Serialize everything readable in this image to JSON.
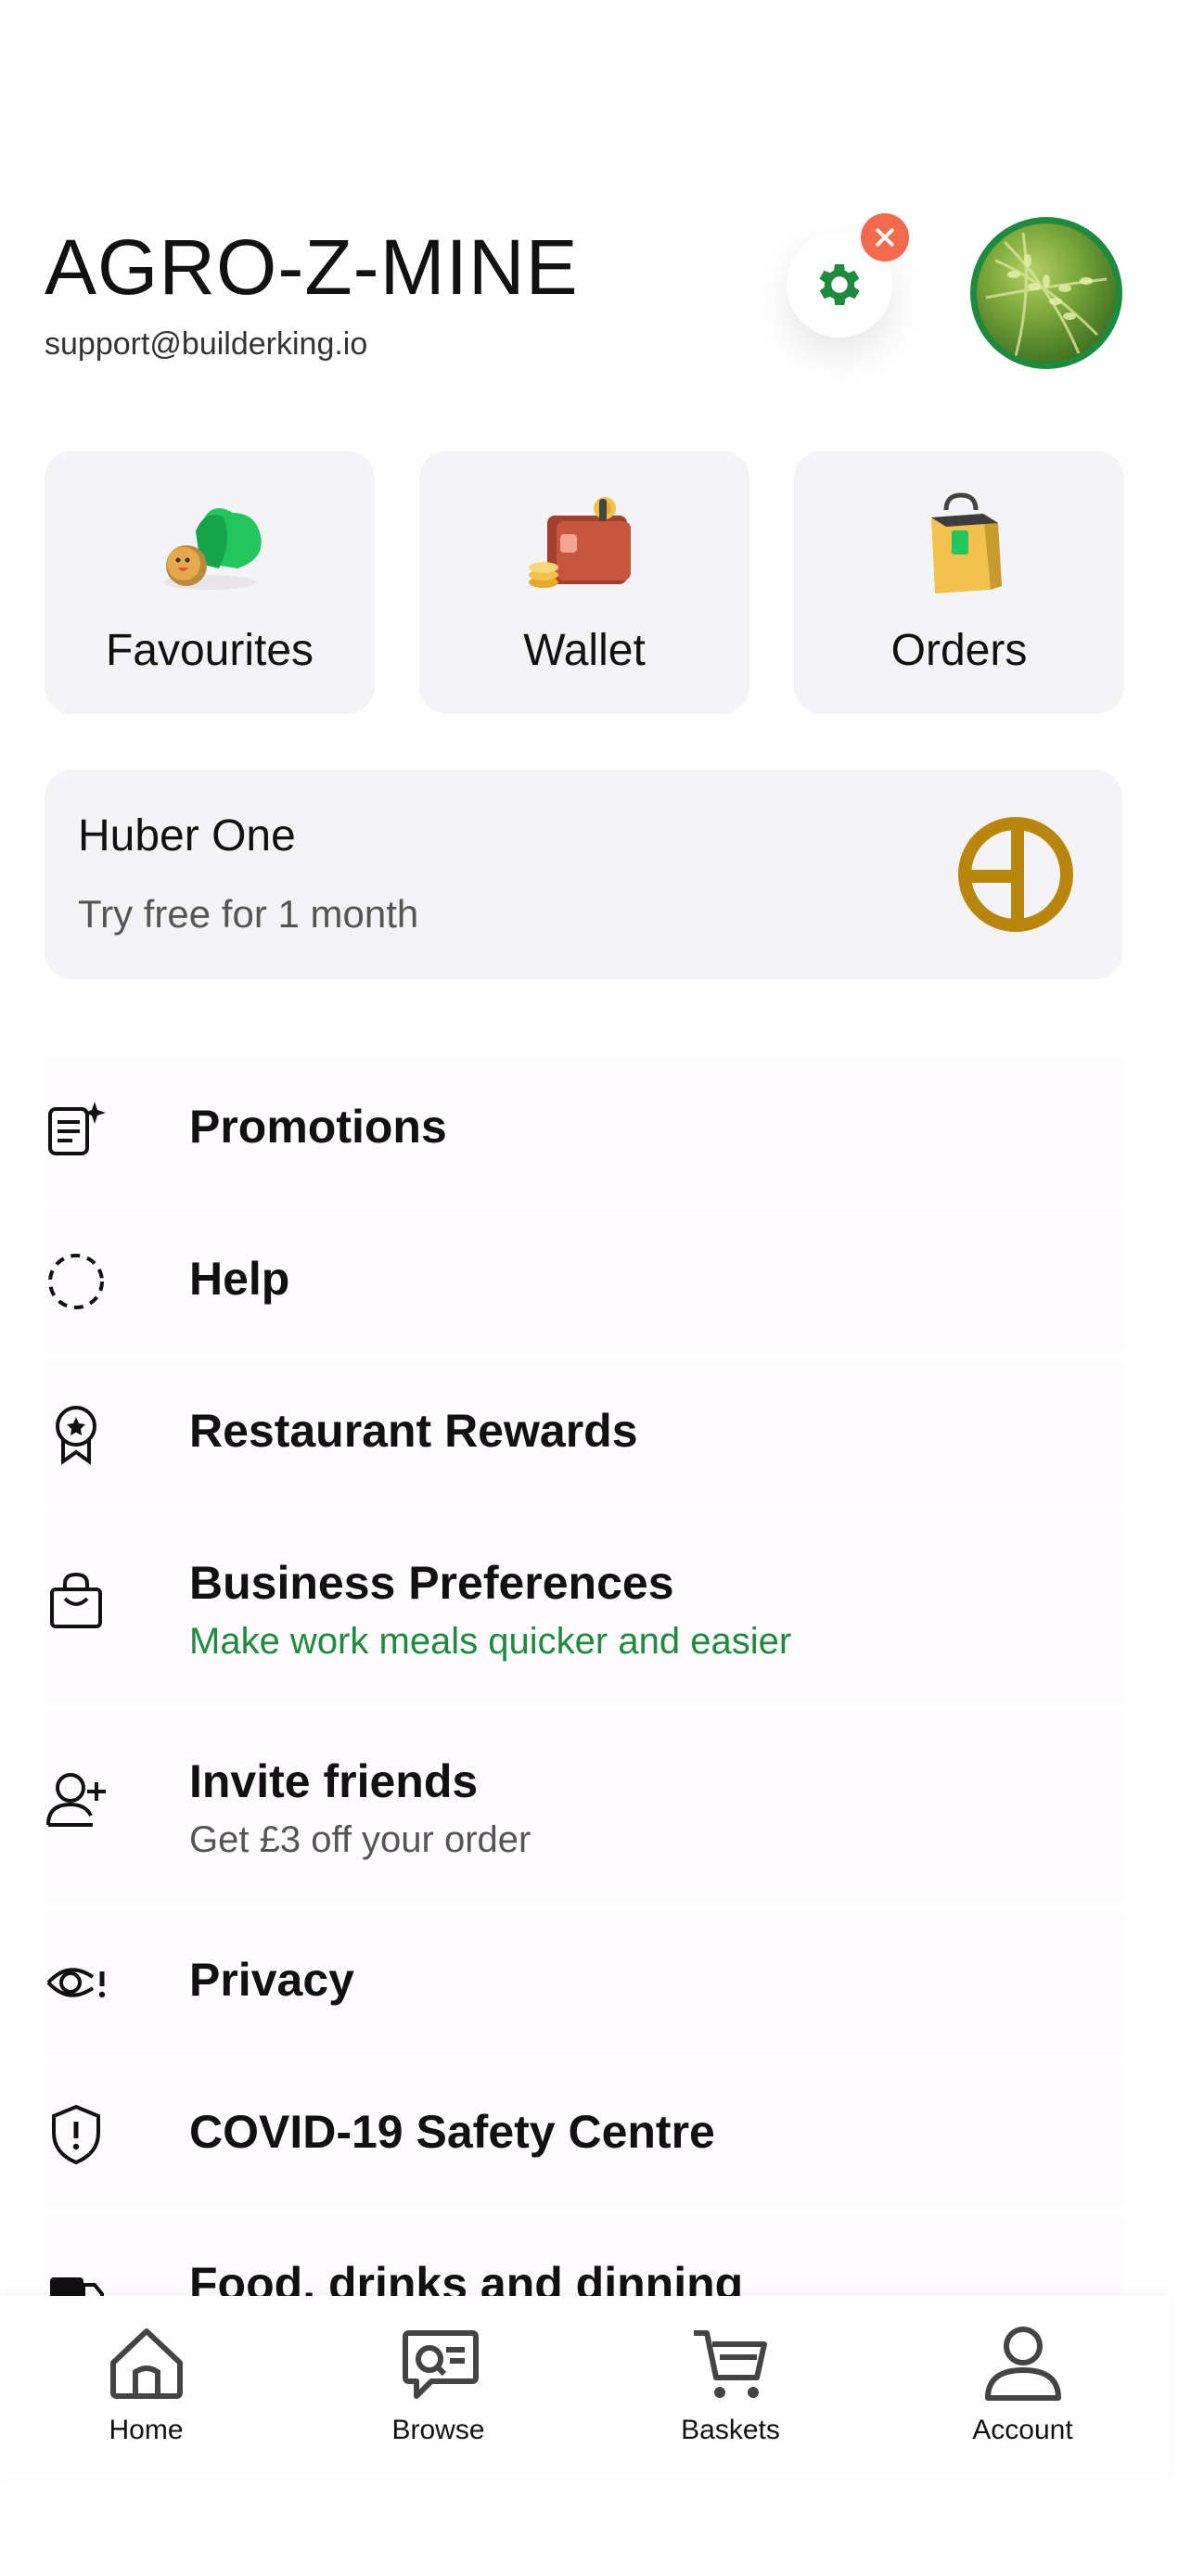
{
  "header": {
    "title": "AGRO-Z-MINE",
    "email": "support@builderking.io",
    "settings_icon": "gear-icon",
    "close_icon": "close-icon"
  },
  "tiles": [
    {
      "label": "Favourites",
      "icon": "favourites-icon"
    },
    {
      "label": "Wallet",
      "icon": "wallet-icon"
    },
    {
      "label": "Orders",
      "icon": "orders-bag-icon"
    }
  ],
  "promo": {
    "title": "Huber One",
    "subtitle": "Try free for 1 month",
    "icon": "huber-one-logo-icon"
  },
  "menu": [
    {
      "label": "Promotions",
      "icon": "promotions-icon"
    },
    {
      "label": "Help",
      "icon": "help-icon"
    },
    {
      "label": "Restaurant Rewards",
      "icon": "rewards-icon"
    },
    {
      "label": "Business Preferences",
      "subtitle": "Make work meals quicker and easier",
      "icon": "shopping-bag-icon"
    },
    {
      "label": "Invite friends",
      "subtitle": "Get £3 off your order",
      "icon": "add-user-icon"
    },
    {
      "label": "Privacy",
      "icon": "privacy-eye-icon"
    },
    {
      "label": "COVID-19 Safety Centre",
      "icon": "shield-icon"
    },
    {
      "label": "Food, drinks and dinning",
      "icon": "delivery-icon"
    }
  ],
  "nav": [
    {
      "label": "Home",
      "icon": "home-icon"
    },
    {
      "label": "Browse",
      "icon": "browse-icon"
    },
    {
      "label": "Baskets",
      "icon": "cart-icon"
    },
    {
      "label": "Account",
      "icon": "account-icon"
    }
  ],
  "colors": {
    "accent_green": "#1d8a3e",
    "badge_orange": "#f26a4b",
    "huber_gold": "#b8860b",
    "tile_bg": "#f4f3f6"
  }
}
